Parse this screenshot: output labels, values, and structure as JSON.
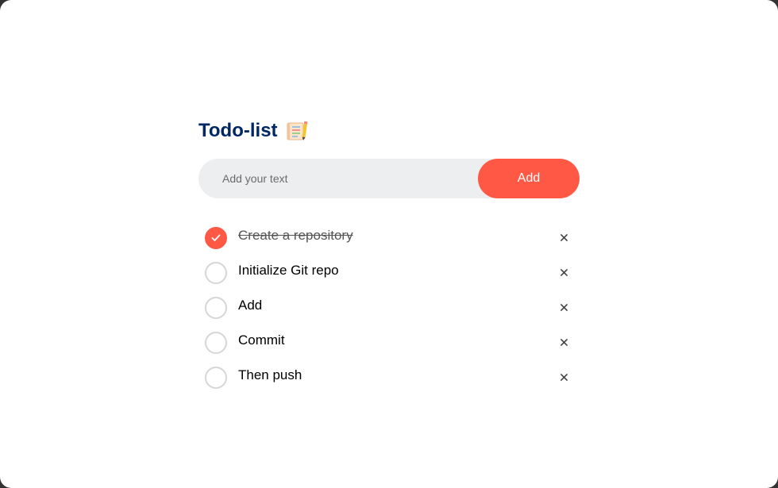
{
  "app": {
    "title": "Todo-list",
    "title_icon": "notepad-emoji-icon"
  },
  "input": {
    "placeholder": "Add your text",
    "value": ""
  },
  "add_button": {
    "label": "Add"
  },
  "colors": {
    "accent": "#ff5945",
    "title": "#002765",
    "input_bg": "#edeef0"
  },
  "tasks": [
    {
      "text": "Create a repository",
      "checked": true
    },
    {
      "text": "Initialize Git repo",
      "checked": false
    },
    {
      "text": "Add",
      "checked": false
    },
    {
      "text": "Commit",
      "checked": false
    },
    {
      "text": "Then push",
      "checked": false
    }
  ]
}
